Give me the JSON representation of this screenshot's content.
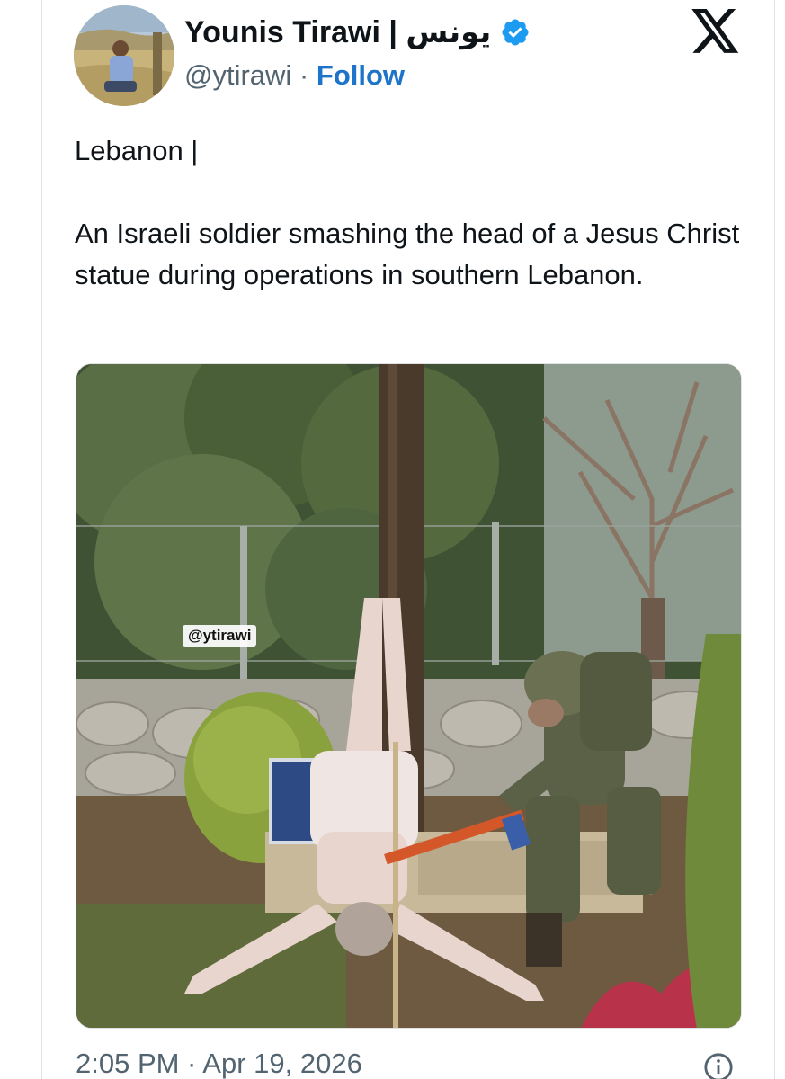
{
  "author": {
    "name": "Younis Tirawi | يونس",
    "handle": "@ytirawi",
    "separator": "·",
    "follow_label": "Follow"
  },
  "tweet": {
    "lines": [
      "Lebanon |",
      "An Israeli soldier smashing the head of a Jesus Christ statue during operations in southern Lebanon."
    ],
    "image_watermark": "@ytirawi"
  },
  "meta": {
    "timestamp": "2:05 PM · Apr 19, 2026"
  },
  "icons": {
    "verified": "verified-badge-icon",
    "logo": "x-logo-icon",
    "info": "info-icon"
  },
  "colors": {
    "accent": "#1d9bf0",
    "follow": "#1d74c8",
    "secondary_text": "#536471"
  }
}
